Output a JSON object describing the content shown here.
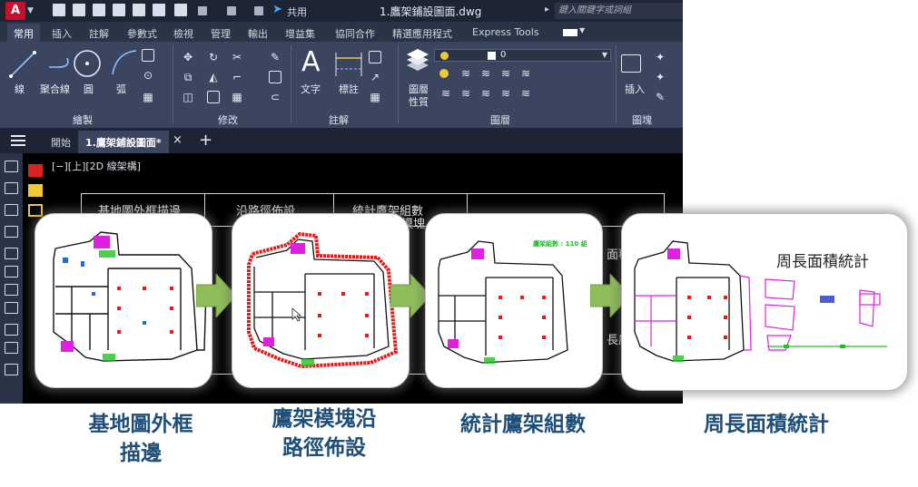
{
  "titlebar": {
    "logo_letter": "A",
    "share_label": "共用",
    "doc_title": "1.鷹架鋪設圖面.dwg",
    "search_placeholder": "鍵入關鍵字或詞組"
  },
  "ribbon_tabs": [
    "常用",
    "插入",
    "註解",
    "參數式",
    "檢視",
    "管理",
    "輸出",
    "增益集",
    "協同合作",
    "精選應用程式",
    "Express Tools"
  ],
  "ribbon": {
    "draw": {
      "line": "線",
      "polyline": "聚合線",
      "circle": "圓",
      "arc": "弧",
      "title": "繪製"
    },
    "modify": {
      "title": "修改"
    },
    "annotation": {
      "text": "文字",
      "dimension": "標註",
      "title": "註解"
    },
    "layers": {
      "properties_line1": "圖層",
      "properties_line2": "性質",
      "current_layer": "0",
      "title": "圖層"
    },
    "block": {
      "insert": "插入",
      "title": "圖塊"
    }
  },
  "doc_tabs": {
    "start": "開始",
    "active": "1.鷹架鋪設圖面*"
  },
  "canvas": {
    "view_label": "[−][上][2D 線架構]",
    "table_headers": [
      "基地圖外框描邊",
      "沿路徑佈設",
      "統計鷹架組數"
    ],
    "table_cell_1": "鷹架模塊",
    "table_cell_2": "面積",
    "table_cell_3": "長度"
  },
  "steps": [
    {
      "caption_line1": "基地圖外框",
      "caption_line2": "描邊"
    },
    {
      "caption_line1": "鷹架模塊沿",
      "caption_line2": "路徑佈設"
    },
    {
      "caption_line1": "統計鷹架組數",
      "caption_line2": ""
    },
    {
      "caption_line1": "周長面積統計",
      "caption_line2": ""
    }
  ],
  "step3_count_label": "鷹架組數 : 110 組",
  "step4_card_title": "周長面積統計",
  "colors": {
    "caption": "#1f4e79",
    "arrow_green": "#8fbd5a",
    "ribbon_bg": "#3b4560",
    "titlebar_bg": "#1d2535",
    "trace_red": "#e31b1b",
    "magenta": "#e020e0"
  }
}
